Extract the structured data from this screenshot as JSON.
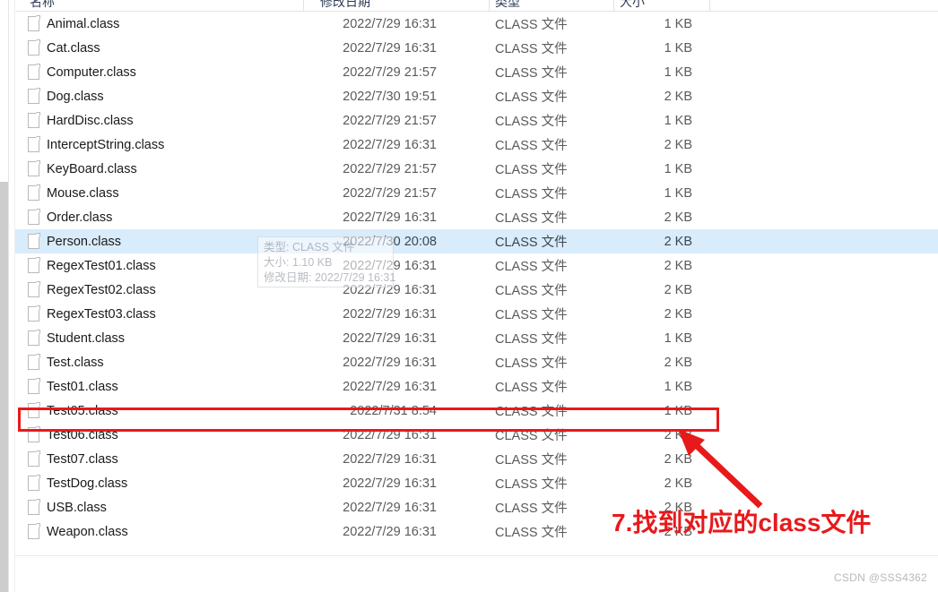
{
  "window": {
    "type": "file-explorer-list-view"
  },
  "columns": {
    "name": "名称",
    "date_modified": "修改日期",
    "type": "类型",
    "size": "大小"
  },
  "files": [
    {
      "name": "Animal.class",
      "date": "2022/7/29 16:31",
      "type": "CLASS 文件",
      "size": "1 KB",
      "selected": false,
      "highlighted": false
    },
    {
      "name": "Cat.class",
      "date": "2022/7/29 16:31",
      "type": "CLASS 文件",
      "size": "1 KB",
      "selected": false,
      "highlighted": false
    },
    {
      "name": "Computer.class",
      "date": "2022/7/29 21:57",
      "type": "CLASS 文件",
      "size": "1 KB",
      "selected": false,
      "highlighted": false
    },
    {
      "name": "Dog.class",
      "date": "2022/7/30 19:51",
      "type": "CLASS 文件",
      "size": "2 KB",
      "selected": false,
      "highlighted": false
    },
    {
      "name": "HardDisc.class",
      "date": "2022/7/29 21:57",
      "type": "CLASS 文件",
      "size": "1 KB",
      "selected": false,
      "highlighted": false
    },
    {
      "name": "InterceptString.class",
      "date": "2022/7/29 16:31",
      "type": "CLASS 文件",
      "size": "2 KB",
      "selected": false,
      "highlighted": false
    },
    {
      "name": "KeyBoard.class",
      "date": "2022/7/29 21:57",
      "type": "CLASS 文件",
      "size": "1 KB",
      "selected": false,
      "highlighted": false
    },
    {
      "name": "Mouse.class",
      "date": "2022/7/29 21:57",
      "type": "CLASS 文件",
      "size": "1 KB",
      "selected": false,
      "highlighted": false
    },
    {
      "name": "Order.class",
      "date": "2022/7/29 16:31",
      "type": "CLASS 文件",
      "size": "2 KB",
      "selected": false,
      "highlighted": false
    },
    {
      "name": "Person.class",
      "date": "2022/7/30 20:08",
      "type": "CLASS 文件",
      "size": "2 KB",
      "selected": true,
      "highlighted": false
    },
    {
      "name": "RegexTest01.class",
      "date": "2022/7/29 16:31",
      "type": "CLASS 文件",
      "size": "2 KB",
      "selected": false,
      "highlighted": false
    },
    {
      "name": "RegexTest02.class",
      "date": "2022/7/29 16:31",
      "type": "CLASS 文件",
      "size": "2 KB",
      "selected": false,
      "highlighted": false
    },
    {
      "name": "RegexTest03.class",
      "date": "2022/7/29 16:31",
      "type": "CLASS 文件",
      "size": "2 KB",
      "selected": false,
      "highlighted": false
    },
    {
      "name": "Student.class",
      "date": "2022/7/29 16:31",
      "type": "CLASS 文件",
      "size": "1 KB",
      "selected": false,
      "highlighted": false
    },
    {
      "name": "Test.class",
      "date": "2022/7/29 16:31",
      "type": "CLASS 文件",
      "size": "2 KB",
      "selected": false,
      "highlighted": false
    },
    {
      "name": "Test01.class",
      "date": "2022/7/29 16:31",
      "type": "CLASS 文件",
      "size": "1 KB",
      "selected": false,
      "highlighted": false
    },
    {
      "name": "Test05.class",
      "date": "2022/7/31 8:54",
      "type": "CLASS 文件",
      "size": "1 KB",
      "selected": false,
      "highlighted": true
    },
    {
      "name": "Test06.class",
      "date": "2022/7/29 16:31",
      "type": "CLASS 文件",
      "size": "2 KB",
      "selected": false,
      "highlighted": false
    },
    {
      "name": "Test07.class",
      "date": "2022/7/29 16:31",
      "type": "CLASS 文件",
      "size": "2 KB",
      "selected": false,
      "highlighted": false
    },
    {
      "name": "TestDog.class",
      "date": "2022/7/29 16:31",
      "type": "CLASS 文件",
      "size": "2 KB",
      "selected": false,
      "highlighted": false
    },
    {
      "name": "USB.class",
      "date": "2022/7/29 16:31",
      "type": "CLASS 文件",
      "size": "2 KB",
      "selected": false,
      "highlighted": false
    },
    {
      "name": "Weapon.class",
      "date": "2022/7/29 16:31",
      "type": "CLASS 文件",
      "size": "2 KB",
      "selected": false,
      "highlighted": false
    }
  ],
  "tooltip": {
    "line1": "类型: CLASS 文件",
    "line2": "大小: 1.10 KB",
    "line3": "修改日期: 2022/7/29 16:31"
  },
  "annotation": {
    "text": "7.找到对应的class文件",
    "color": "#e8191b"
  },
  "watermark": {
    "text": "CSDN @SSS4362"
  }
}
